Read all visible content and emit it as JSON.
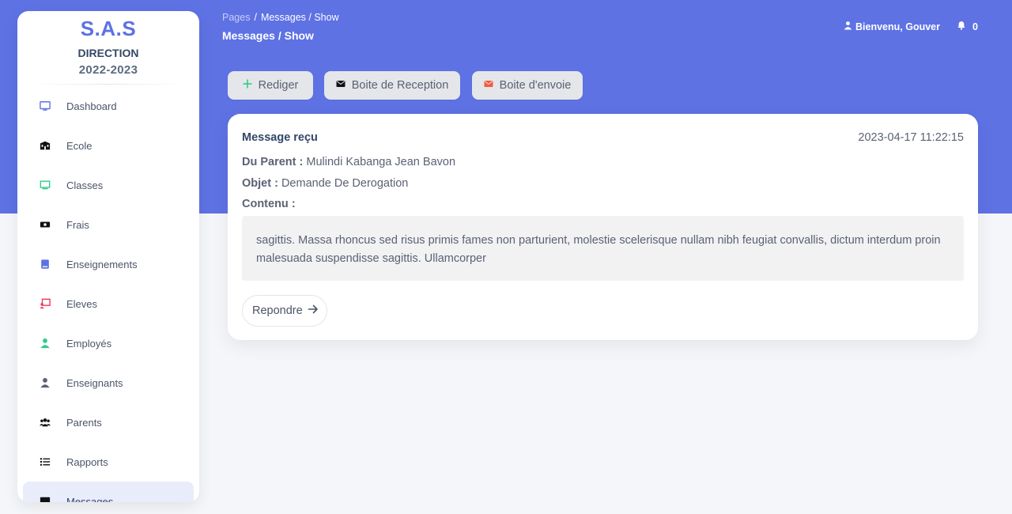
{
  "sidebar": {
    "brand_name": "S.A.S",
    "brand_sub": "DIRECTION",
    "brand_year": "2022-2023",
    "items": [
      {
        "label": "Dashboard",
        "icon": "monitor-icon",
        "color": "#5e72e4"
      },
      {
        "label": "Ecole",
        "icon": "school-icon",
        "color": "#111111"
      },
      {
        "label": "Classes",
        "icon": "chalkboard-icon",
        "color": "#2dce89"
      },
      {
        "label": "Frais",
        "icon": "money-bill-icon",
        "color": "#111111"
      },
      {
        "label": "Enseignements",
        "icon": "book-icon",
        "color": "#5e72e4"
      },
      {
        "label": "Eleves",
        "icon": "student-board-icon",
        "color": "#f5365c"
      },
      {
        "label": "Employés",
        "icon": "user-icon",
        "color": "#2dce89"
      },
      {
        "label": "Enseignants",
        "icon": "user-icon",
        "color": "#5a6273"
      },
      {
        "label": "Parents",
        "icon": "users-icon",
        "color": "#111111"
      },
      {
        "label": "Rapports",
        "icon": "list-icon",
        "color": "#111111"
      },
      {
        "label": "Messages",
        "icon": "message-icon",
        "color": "#111111",
        "active": true
      }
    ]
  },
  "topbar": {
    "breadcrumb_root": "Pages",
    "breadcrumb_current": "Messages / Show",
    "page_title": "Messages / Show",
    "user_greeting": "Bienvenu, Gouver",
    "notification_count": "0"
  },
  "actions": {
    "compose": "Rediger",
    "inbox": "Boite de Reception",
    "outbox": "Boite d'envoie"
  },
  "message": {
    "title": "Message reçu",
    "date": "2023-04-17 11:22:15",
    "from_label": "Du Parent :",
    "from_value": "Mulindi Kabanga Jean Bavon",
    "subject_label": "Objet :",
    "subject_value": "Demande De Derogation",
    "content_label": "Contenu :",
    "content": "sagittis. Massa rhoncus sed risus primis fames non parturient, molestie scelerisque nullam nibh feugiat convallis, dictum interdum proin malesuada suspendisse sagittis. Ullamcorper",
    "reply_label": "Repondre"
  },
  "colors": {
    "accent": "#5e72e4",
    "success": "#2dce89",
    "danger": "#f5365c",
    "envelope_red": "#f5593d"
  }
}
